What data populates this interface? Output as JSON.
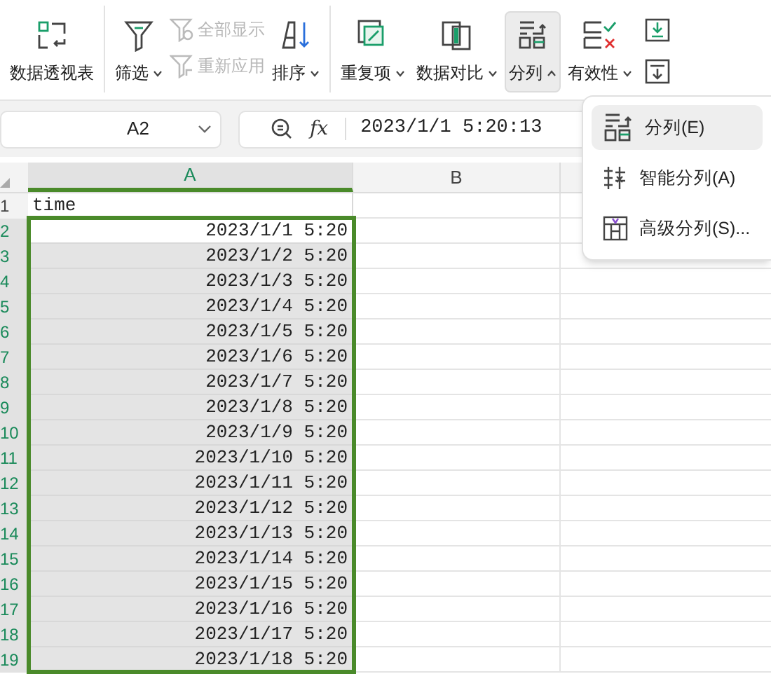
{
  "ribbon": {
    "buttons": [
      {
        "kind": "large",
        "label": "数据透视表",
        "caret": false,
        "expanded": false
      },
      {
        "kind": "divider"
      },
      {
        "kind": "large",
        "label": "筛选",
        "caret": true,
        "expanded": false
      },
      {
        "kind": "pair",
        "items": [
          {
            "label": "全部显示",
            "disabled": true
          },
          {
            "label": "重新应用",
            "disabled": true
          }
        ]
      },
      {
        "kind": "large",
        "label": "排序",
        "caret": true,
        "expanded": false
      },
      {
        "kind": "divider"
      },
      {
        "kind": "large",
        "label": "重复项",
        "caret": true,
        "expanded": false
      },
      {
        "kind": "large",
        "label": "数据对比",
        "caret": true,
        "expanded": false
      },
      {
        "kind": "large",
        "label": "分列",
        "caret": true,
        "expanded": true
      },
      {
        "kind": "large",
        "label": "有效性",
        "caret": true,
        "expanded": false
      },
      {
        "kind": "cut"
      }
    ]
  },
  "name_box": "A2",
  "function_label": "fx",
  "formula": "2023/1/1 5:20:13",
  "menu": {
    "items": [
      {
        "label": "分列(E)",
        "selected": true
      },
      {
        "label": "智能分列(A)",
        "selected": false
      },
      {
        "label": "高级分列(S)...",
        "selected": false
      }
    ]
  },
  "columns": [
    {
      "label": "A",
      "selected": true
    },
    {
      "label": "B",
      "selected": false
    }
  ],
  "rows": [
    {
      "number": "1",
      "value": "time",
      "selected": false,
      "active": false
    },
    {
      "number": "2",
      "value": "2023/1/1 5:20",
      "selected": true,
      "active": true
    },
    {
      "number": "3",
      "value": "2023/1/2 5:20",
      "selected": true,
      "active": false
    },
    {
      "number": "4",
      "value": "2023/1/3 5:20",
      "selected": true,
      "active": false
    },
    {
      "number": "5",
      "value": "2023/1/4 5:20",
      "selected": true,
      "active": false
    },
    {
      "number": "6",
      "value": "2023/1/5 5:20",
      "selected": true,
      "active": false
    },
    {
      "number": "7",
      "value": "2023/1/6 5:20",
      "selected": true,
      "active": false
    },
    {
      "number": "8",
      "value": "2023/1/7 5:20",
      "selected": true,
      "active": false
    },
    {
      "number": "9",
      "value": "2023/1/8 5:20",
      "selected": true,
      "active": false
    },
    {
      "number": "10",
      "value": "2023/1/9 5:20",
      "selected": true,
      "active": false
    },
    {
      "number": "11",
      "value": "2023/1/10 5:20",
      "selected": true,
      "active": false
    },
    {
      "number": "12",
      "value": "2023/1/11 5:20",
      "selected": true,
      "active": false
    },
    {
      "number": "13",
      "value": "2023/1/12 5:20",
      "selected": true,
      "active": false
    },
    {
      "number": "14",
      "value": "2023/1/13 5:20",
      "selected": true,
      "active": false
    },
    {
      "number": "15",
      "value": "2023/1/14 5:20",
      "selected": true,
      "active": false
    },
    {
      "number": "16",
      "value": "2023/1/15 5:20",
      "selected": true,
      "active": false
    },
    {
      "number": "17",
      "value": "2023/1/16 5:20",
      "selected": true,
      "active": false
    },
    {
      "number": "18",
      "value": "2023/1/17 5:20",
      "selected": true,
      "active": false
    },
    {
      "number": "19",
      "value": "2023/1/18 5:20",
      "selected": true,
      "active": false
    }
  ]
}
